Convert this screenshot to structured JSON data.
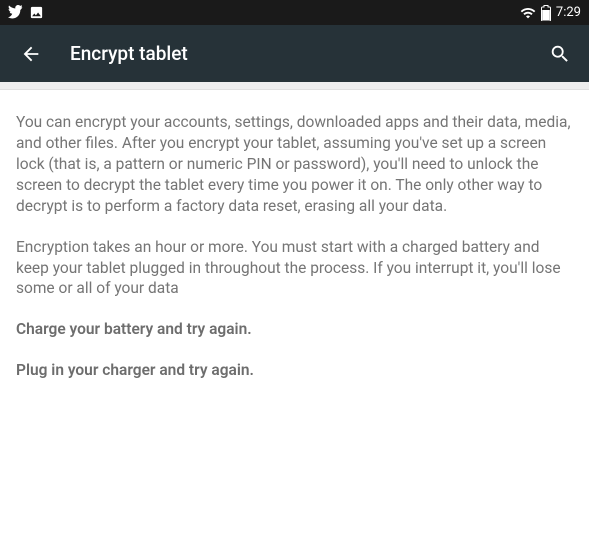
{
  "status_bar": {
    "time": "7:29"
  },
  "app_bar": {
    "title": "Encrypt tablet"
  },
  "content": {
    "paragraph1": "You can encrypt your accounts, settings, downloaded apps and their data, media, and other files. After you encrypt your tablet, assuming you've set up a screen lock (that is, a pattern or numeric PIN or password), you'll need to unlock the screen to decrypt the tablet every time you power it on. The only other way to decrypt is to perform a factory data reset, erasing all your data.",
    "paragraph2": "Encryption takes an hour or more. You must start with a charged battery and keep your tablet plugged in throughout the process. If you interrupt it, you'll lose some or all of your data",
    "warning1": "Charge your battery and try again.",
    "warning2": "Plug in your charger and try again."
  }
}
